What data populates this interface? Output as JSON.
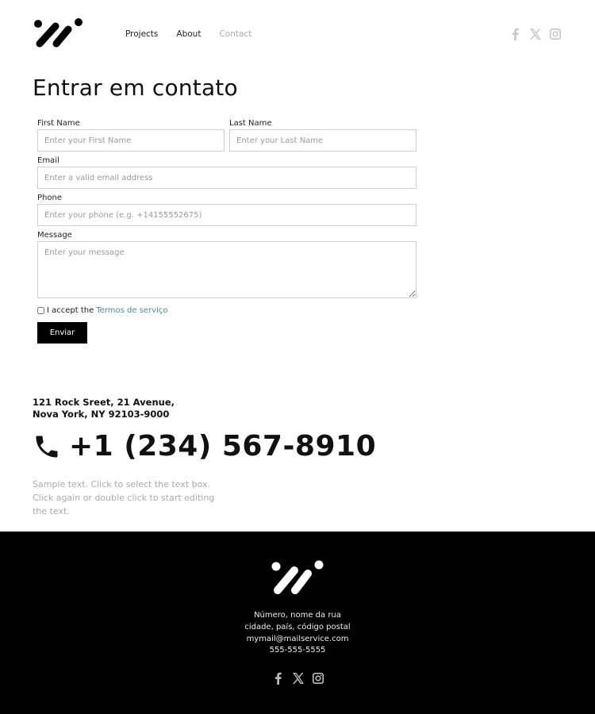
{
  "header": {
    "logo": "brand-logo",
    "nav": [
      {
        "label": "Projects",
        "active": false
      },
      {
        "label": "About",
        "active": false
      },
      {
        "label": "Contact",
        "active": true
      }
    ],
    "social": [
      "facebook-icon",
      "x-icon",
      "instagram-icon"
    ]
  },
  "page": {
    "title": "Entrar em contato"
  },
  "form": {
    "first_name": {
      "label": "First Name",
      "placeholder": "Enter your First Name"
    },
    "last_name": {
      "label": "Last Name",
      "placeholder": "Enter your Last Name"
    },
    "email": {
      "label": "Email",
      "placeholder": "Enter a valid email address"
    },
    "phone": {
      "label": "Phone",
      "placeholder": "Enter your phone (e.g. +14155552675)"
    },
    "message": {
      "label": "Message",
      "placeholder": "Enter your message"
    },
    "consent": {
      "text": "I accept the",
      "link": "Termos de serviço",
      "checked": false
    },
    "submit_label": "Enviar"
  },
  "contact": {
    "address_line1": "121 Rock Sreet, 21 Avenue,",
    "address_line2": "Nova York, NY 92103-9000",
    "phone": "+1 (234) 567-8910",
    "sample_text": "Sample text. Click to select the text box. Click again or double click to start editing the text."
  },
  "footer": {
    "lines": [
      "Número, nome da rua",
      "cidade, país, código postal",
      "mymail@mailservice.com",
      "555-555-5555"
    ],
    "social": [
      "facebook-icon",
      "x-icon",
      "instagram-icon"
    ]
  },
  "colors": {
    "link": "#4a86a8",
    "footer_bg": "#000000",
    "button_bg": "#000000"
  }
}
